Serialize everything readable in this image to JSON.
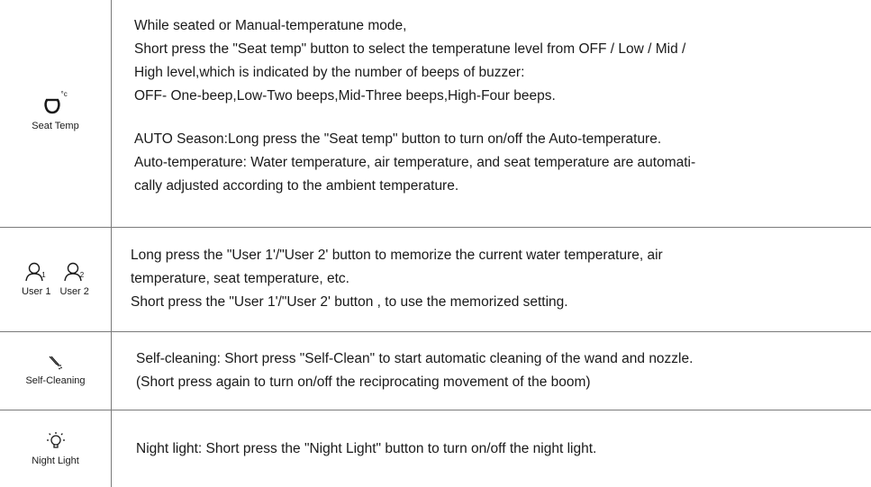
{
  "rows": [
    {
      "icons": [
        {
          "name": "seat-temp-icon",
          "label": "Seat Temp",
          "sup": "°c"
        }
      ],
      "lines": [
        "While seated or Manual-temperatune mode,",
        "Short press the \"Seat temp\" button to select the temperatune level from OFF / Low / Mid /",
        "High level,which is indicated by the number of  beeps of  buzzer:",
        "OFF- One-beep,Low-Two beeps,Mid-Three beeps,High-Four beeps.",
        "AUTO Season:Long press the \"Seat temp\" button to turn on/off the Auto-temperature.",
        "Auto-temperature: Water temperature, air temperature, and seat temperature are automati-",
        "cally adjusted according to the ambient temperature."
      ]
    },
    {
      "icons": [
        {
          "name": "user-icon",
          "label": "User 1",
          "sub": "1"
        },
        {
          "name": "user-icon",
          "label": "User 2",
          "sub": "2"
        }
      ],
      "lines": [
        "Long press the \"User 1'/\"User 2' button to memorize the current water temperature, air",
        "temperature, seat temperature, etc.",
        "Short press the \"User 1'/\"User 2' button , to use the memorized setting."
      ]
    },
    {
      "icons": [
        {
          "name": "self-clean-wand-icon",
          "label": "Self-Cleaning"
        }
      ],
      "lines": [
        "Self-cleaning: Short press \"Self-Clean\" to start automatic cleaning of the wand and nozzle.",
        "(Short press again to turn on/off the reciprocating movement of the boom)"
      ]
    },
    {
      "icons": [
        {
          "name": "light-bulb-icon",
          "label": "Night  Light"
        }
      ],
      "lines": [
        "Night light: Short press the \"Night Light\" button to turn on/off the night light."
      ]
    }
  ]
}
